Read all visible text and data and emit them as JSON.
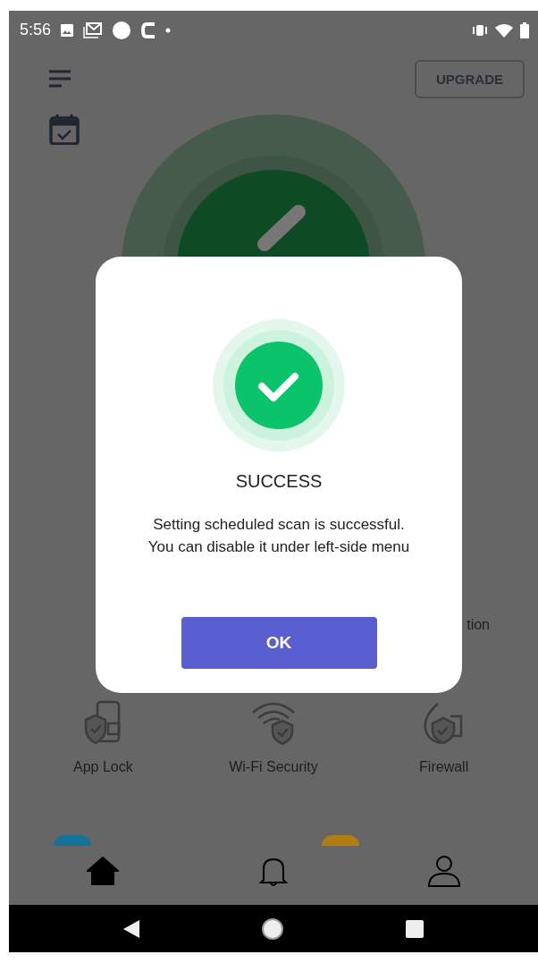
{
  "status_bar": {
    "time": "5:56"
  },
  "header": {
    "upgrade_button": "UPGRADE"
  },
  "feature_row_partial": {
    "label": "tion"
  },
  "features": [
    {
      "kind": "app-lock",
      "label": "App Lock"
    },
    {
      "kind": "wifi",
      "label": "Wi-Fi Security"
    },
    {
      "kind": "firewall",
      "label": "Firewall"
    }
  ],
  "badges": [
    {
      "color": "#13739a"
    },
    {
      "color": "#b07d12"
    }
  ],
  "bottom_nav": [
    {
      "kind": "home",
      "selected": true
    },
    {
      "kind": "bell",
      "selected": false
    },
    {
      "kind": "profile",
      "selected": false
    }
  ],
  "dialog": {
    "title": "SUCCESS",
    "message": "Setting scheduled scan is successful.\nYou can disable it under left-side menu",
    "button": "OK"
  }
}
